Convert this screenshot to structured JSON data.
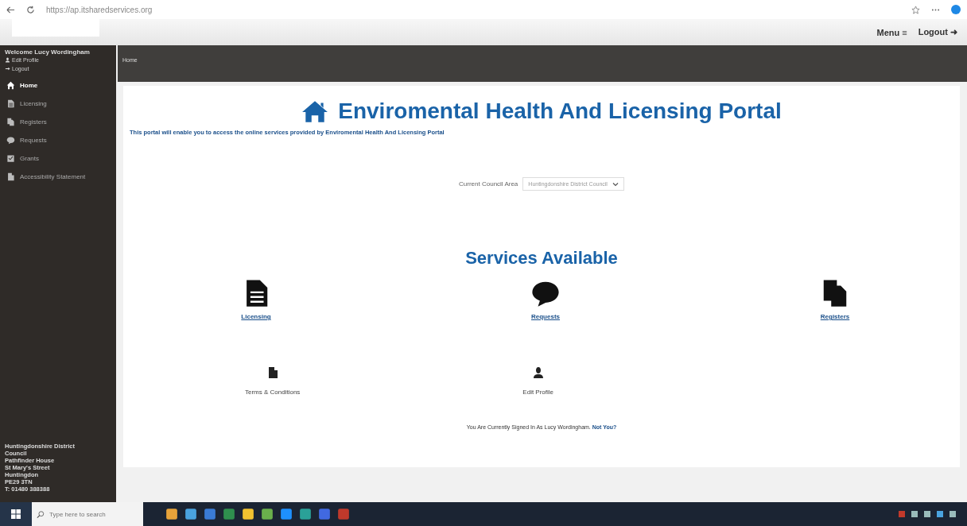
{
  "browser": {
    "url": "https://ap.itsharedservices.org"
  },
  "header": {
    "menu": "Menu",
    "menu_icon": "≡",
    "logout": "Logout",
    "logout_icon": "➜"
  },
  "sidebar": {
    "welcome": "Welcome Lucy Wordingham",
    "links": [
      {
        "label": "Edit Profile",
        "kind": "profile"
      },
      {
        "label": "Logout",
        "kind": "logout"
      }
    ],
    "items": [
      {
        "label": "Home",
        "kind": "home",
        "selected": true
      },
      {
        "label": "Licensing",
        "kind": "doc",
        "selected": false
      },
      {
        "label": "Registers",
        "kind": "files",
        "selected": false
      },
      {
        "label": "Requests",
        "kind": "chat",
        "selected": false
      },
      {
        "label": "Grants",
        "kind": "check",
        "selected": false
      },
      {
        "label": "Accessibility Statement",
        "kind": "page",
        "selected": false
      }
    ],
    "address": [
      "Huntingdonshire District",
      "Council",
      "Pathfinder House",
      "St Mary's Street",
      "Huntingdon",
      "PE29 3TN",
      "T: 01480 388388"
    ]
  },
  "breadcrumb": "Home",
  "title": "Enviromental Health And Licensing Portal",
  "intro": "This portal will enable you to access the online services provided by Enviromental Health And Licensing Portal",
  "council": {
    "label": "Current Council Area",
    "value": "Huntingdonshire District Council"
  },
  "services_title": "Services Available",
  "services": [
    {
      "label": "Licensing",
      "kind": "doc"
    },
    {
      "label": "Requests",
      "kind": "chat"
    },
    {
      "label": "Registers",
      "kind": "files"
    }
  ],
  "extras": [
    {
      "label": "Terms & Conditions",
      "kind": "page"
    },
    {
      "label": "Edit Profile",
      "kind": "profile"
    }
  ],
  "signed_in": {
    "text": "You Are Currently Signed In As Lucy Wordingham.",
    "link": "Not You?"
  },
  "taskbar": {
    "search_placeholder": "Type here to search"
  }
}
